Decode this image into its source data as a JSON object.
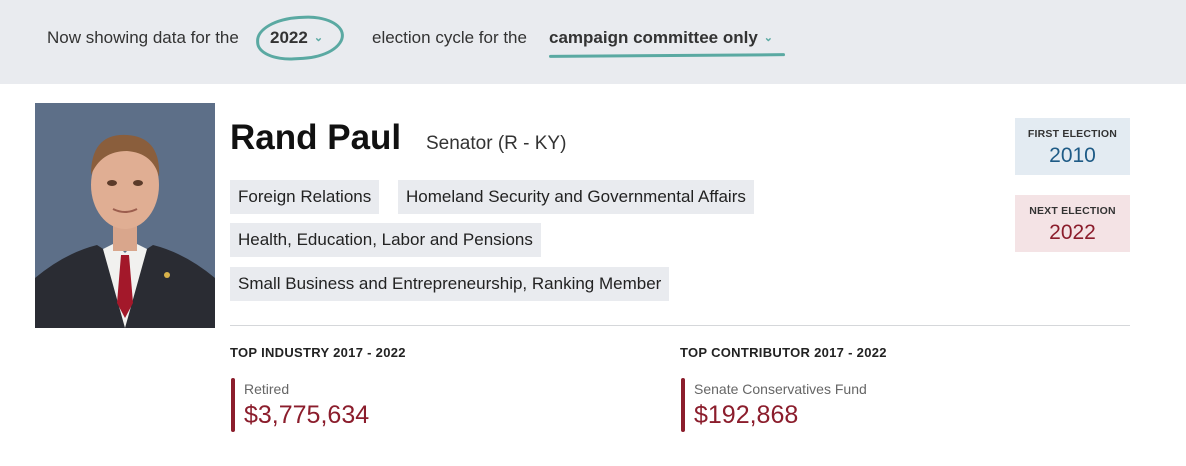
{
  "filter": {
    "prefix": "Now showing data for the",
    "year": "2022",
    "middle": "election cycle for the",
    "committee": "campaign committee only"
  },
  "profile": {
    "name": "Rand Paul",
    "role": "Senator (R - KY)",
    "committees": [
      "Foreign Relations",
      "Homeland Security and Governmental Affairs",
      "Health, Education, Labor and Pensions",
      "Small Business and Entrepreneurship, Ranking Member"
    ]
  },
  "elections": {
    "first_label": "FIRST ELECTION",
    "first_year": "2010",
    "next_label": "NEXT ELECTION",
    "next_year": "2022"
  },
  "stats": {
    "industry_heading": "TOP INDUSTRY 2017 - 2022",
    "industry_name": "Retired",
    "industry_amount": "$3,775,634",
    "contributor_heading": "TOP CONTRIBUTOR 2017 - 2022",
    "contributor_name": "Senate Conservatives Fund",
    "contributor_amount": "$192,868"
  },
  "colors": {
    "accent_teal": "#5aa9a2",
    "accent_red": "#8b1d2c",
    "first_election_blue": "#1e5b86"
  }
}
